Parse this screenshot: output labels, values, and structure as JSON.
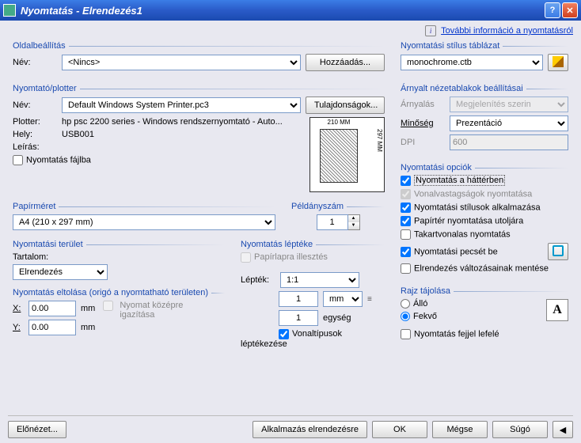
{
  "title": "Nyomtatás - Elrendezés1",
  "moreinfo": "További információ a nyomtatásról",
  "page": {
    "title": "Oldalbeállítás",
    "name_lbl": "Név:",
    "name_val": "<Nincs>",
    "add_btn": "Hozzáadás..."
  },
  "printer": {
    "title": "Nyomtató/plotter",
    "name_lbl": "Név:",
    "name_val": "Default Windows System Printer.pc3",
    "props_btn": "Tulajdonságok...",
    "plotter_lbl": "Plotter:",
    "plotter_val": "hp psc 2200 series - Windows rendszernyomtató - Auto...",
    "where_lbl": "Hely:",
    "where_val": "USB001",
    "desc_lbl": "Leírás:",
    "tofile": "Nyomtatás fájlba",
    "dim_w": "210 MM",
    "dim_h": "297 MM"
  },
  "paper": {
    "title": "Papírméret",
    "val": "A4 (210 x 297 mm)"
  },
  "copies": {
    "title": "Példányszám",
    "val": "1"
  },
  "area": {
    "title": "Nyomtatási terület",
    "range_lbl": "Tartalom:",
    "range_val": "Elrendezés"
  },
  "scale": {
    "title": "Nyomtatás léptéke",
    "fit": "Papírlapra illesztés",
    "scale_lbl": "Lépték:",
    "scale_val": "1:1",
    "num1": "1",
    "unit": "mm",
    "num2": "1",
    "unit2": "egység",
    "lw": "Vonaltípusok léptékezése"
  },
  "offset": {
    "title": "Nyomtatás eltolása (origó a nyomtatható területen)",
    "x_lbl": "X:",
    "x_val": "0.00",
    "y_lbl": "Y:",
    "y_val": "0.00",
    "mm": "mm",
    "center": "Nyomat középre igazítása"
  },
  "style": {
    "title": "Nyomtatási stílus táblázat",
    "val": "monochrome.ctb"
  },
  "shade": {
    "title": "Árnyalt nézetablakok beállításai",
    "s_lbl": "Árnyalás",
    "s_val": "Megjelenítés szerin",
    "q_lbl": "Minőség",
    "q_val": "Prezentáció",
    "d_lbl": "DPI",
    "d_val": "600"
  },
  "opts": {
    "title": "Nyomtatási opciók",
    "bg": "Nyomtatás a háttérben",
    "lw": "Vonalvastagságok nyomtatása",
    "ps": "Nyomtatási stílusok alkalmazása",
    "pe": "Papírtér nyomtatása utoljára",
    "hp": "Takartvonalas nyomtatás",
    "st": "Nyomtatási pecsét be",
    "sv": "Elrendezés változásainak mentése"
  },
  "orient": {
    "title": "Rajz tájolása",
    "p": "Álló",
    "l": "Fekvő",
    "ud": "Nyomtatás fejjel lefelé"
  },
  "btns": {
    "preview": "Előnézet...",
    "apply": "Alkalmazás elrendezésre",
    "ok": "OK",
    "cancel": "Mégse",
    "help": "Súgó"
  }
}
